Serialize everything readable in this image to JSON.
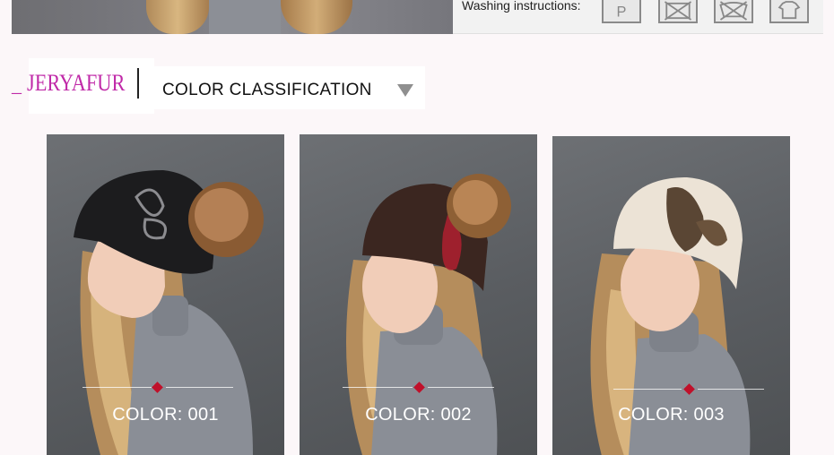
{
  "header": {
    "washing_label": "Washing instructions:",
    "wash_icons": [
      "professional-dry-clean-p-icon",
      "do-not-wash-icon",
      "do-not-bleach-icon",
      "do-not-tumble-dry-icon"
    ]
  },
  "brand": {
    "prefix": "_",
    "name": "JERYAFUR",
    "color": "#c02aa8"
  },
  "section": {
    "title": "COLOR CLASSIFICATION",
    "arrow_icon": "triangle-down-icon"
  },
  "products": [
    {
      "label": "COLOR: 001",
      "hat_color": "#1c1c1e"
    },
    {
      "label": "COLOR: 002",
      "hat_color": "#3b2620"
    },
    {
      "label": "COLOR: 003",
      "hat_color": "#ece3d6"
    }
  ],
  "accent": "#c0102a"
}
